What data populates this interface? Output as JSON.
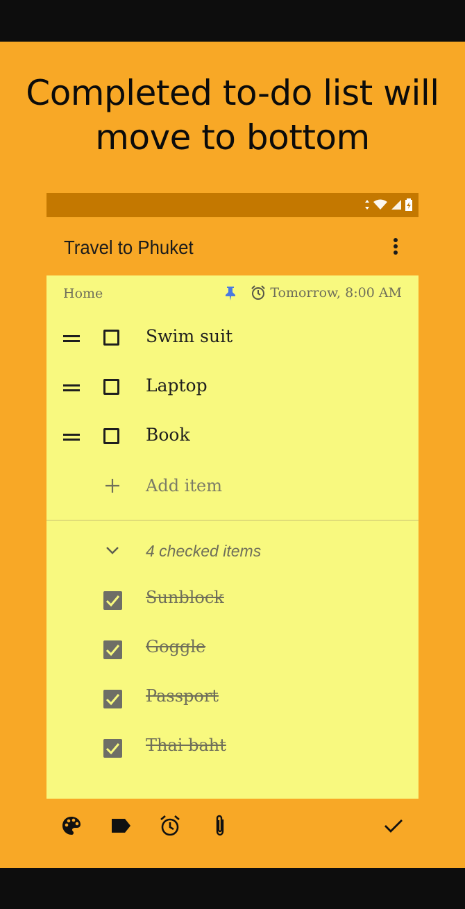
{
  "promo": {
    "headline_line1": "Completed to-do list will",
    "headline_line2": "move to bottom"
  },
  "note": {
    "title": "Travel to Phuket",
    "label": "Home",
    "reminder": "Tomorrow, 8:00 AM",
    "unchecked_items": [
      {
        "text": "Swim suit"
      },
      {
        "text": "Laptop"
      },
      {
        "text": "Book"
      }
    ],
    "add_item_placeholder": "Add item",
    "checked_summary": "4 checked items",
    "checked_items": [
      {
        "text": "Sunblock"
      },
      {
        "text": "Goggle"
      },
      {
        "text": "Passport"
      },
      {
        "text": "Thai baht"
      }
    ]
  },
  "toolbar": {
    "icons": [
      "palette-icon",
      "label-icon",
      "reminder-icon",
      "attach-icon",
      "done-icon"
    ]
  },
  "colors": {
    "background": "#f8a826",
    "status_bar": "#c47800",
    "note": "#f8f97f",
    "pin": "#4a79e0"
  }
}
